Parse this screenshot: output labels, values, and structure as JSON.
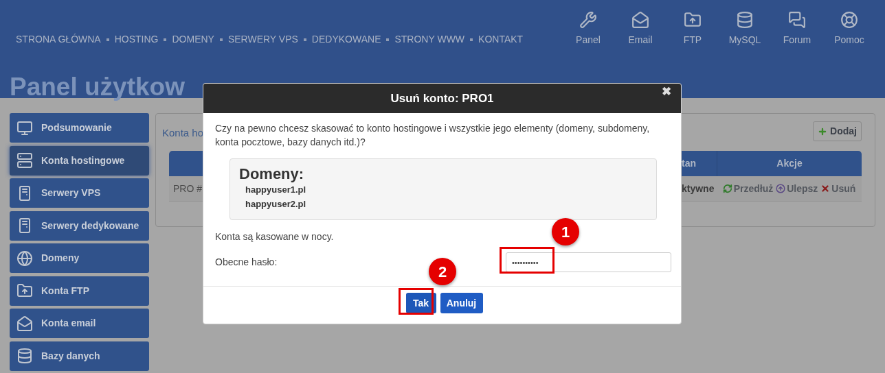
{
  "nav": {
    "items": [
      "STRONA GŁÓWNA",
      "HOSTING",
      "DOMENY",
      "SERWERY VPS",
      "DEDYKOWANE",
      "STRONY WWW",
      "KONTAKT"
    ]
  },
  "quick_links": [
    {
      "kind": "tools",
      "label": "Panel"
    },
    {
      "kind": "mail",
      "label": "Email"
    },
    {
      "kind": "folder",
      "label": "FTP"
    },
    {
      "kind": "database",
      "label": "MySQL"
    },
    {
      "kind": "chat",
      "label": "Forum"
    },
    {
      "kind": "help",
      "label": "Pomoc"
    }
  ],
  "page_title": "Panel użytkow",
  "sidebar": {
    "items": [
      {
        "kind": "monitor",
        "label": "Podsumowanie",
        "selected": false
      },
      {
        "kind": "rack",
        "label": "Konta hostingowe",
        "selected": true
      },
      {
        "kind": "tower",
        "label": "Serwery VPS",
        "selected": false
      },
      {
        "kind": "tower",
        "label": "Serwery dedykowane",
        "selected": false
      },
      {
        "kind": "globe",
        "label": "Domeny",
        "selected": false
      },
      {
        "kind": "folder",
        "label": "Konta FTP",
        "selected": false
      },
      {
        "kind": "mail",
        "label": "Konta email",
        "selected": false
      },
      {
        "kind": "database",
        "label": "Bazy danych",
        "selected": false
      }
    ]
  },
  "panel": {
    "title": "Konta ho",
    "add_button": "Dodaj",
    "table": {
      "columns": [
        "tan",
        "Akcje"
      ],
      "rows": [
        {
          "column_1": "PRO #",
          "status": "ktywne",
          "actions": [
            {
              "kind": "renew",
              "label": "Przedłuż"
            },
            {
              "kind": "upgrade",
              "label": "Ulepsz"
            },
            {
              "kind": "delete",
              "label": "Usuń"
            }
          ]
        }
      ]
    }
  },
  "dialog": {
    "title": "Usuń konto: PRO1",
    "close": "✖",
    "question": "Czy na pewno chcesz skasować to konto hostingowe i wszystkie jego elementy (domeny, subdomeny, konta pocztowe, bazy danych itd.)?",
    "domains_heading": "Domeny:",
    "domains": [
      "happyuser1.pl",
      "happyuser2.pl"
    ],
    "note": "Konta są kasowane w nocy.",
    "password_label": "Obecne hasło:",
    "password_value": "••••••••••",
    "buttons": [
      {
        "kind": "primary",
        "label": "Tak"
      },
      {
        "kind": "secondary",
        "label": "Anuluj"
      }
    ]
  },
  "annotations": [
    {
      "label": "1"
    },
    {
      "label": "2"
    }
  ]
}
